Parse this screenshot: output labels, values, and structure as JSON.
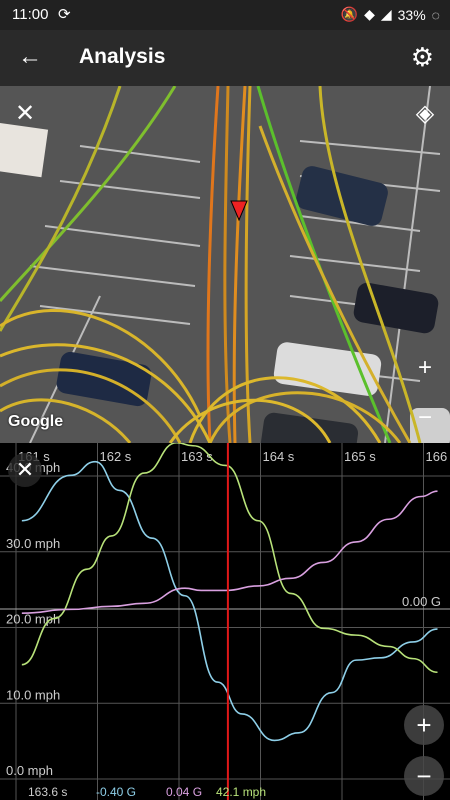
{
  "status": {
    "time": "11:00",
    "battery": "33%"
  },
  "header": {
    "title": "Analysis"
  },
  "icons": {
    "back": "arrow-back-icon",
    "settings": "gear-icon",
    "close": "close-icon",
    "layers": "layers-icon",
    "zoom_in": "plus-icon",
    "zoom_out": "minus-icon",
    "sync": "sync-icon"
  },
  "map": {
    "attribution": "Google"
  },
  "chart_data": {
    "type": "line",
    "x_ticks": [
      "161 s",
      "162 s",
      "163 s",
      "164 s",
      "165 s",
      "166"
    ],
    "y_ticks": [
      "40.0 mph",
      "30.0 mph",
      "20.0 mph",
      "10.0 mph",
      "0.0 mph"
    ],
    "g_label": "0.00 G",
    "series": [
      {
        "color": "#8ecfe8",
        "x": [
          160.9,
          161.5,
          161.8,
          162.1,
          162.5,
          162.9,
          163.3,
          163.6,
          164.0,
          164.3,
          164.7,
          165.0,
          165.3,
          165.7,
          166.0
        ],
        "y": [
          33.3,
          39.3,
          41.1,
          37.3,
          31.0,
          23.4,
          12.0,
          7.8,
          4.3,
          5.3,
          10.6,
          14.9,
          15.2,
          17.3,
          19.0
        ]
      },
      {
        "color": "#b8e27a",
        "x": [
          160.9,
          161.3,
          161.7,
          162.0,
          162.4,
          162.8,
          163.0,
          163.4,
          163.8,
          164.2,
          164.6,
          165.0,
          165.4,
          165.7,
          166.0
        ],
        "y": [
          14.3,
          20.4,
          26.9,
          31.3,
          39.6,
          43.6,
          43.2,
          40.6,
          33.3,
          23.7,
          19.1,
          18.2,
          16.7,
          15.1,
          13.3
        ]
      },
      {
        "color": "#d9a0e0",
        "x": [
          160.9,
          161.5,
          162.0,
          162.4,
          162.9,
          163.1,
          163.4,
          163.8,
          164.2,
          164.6,
          165.0,
          165.4,
          165.8,
          166.0
        ],
        "y": [
          21.1,
          21.6,
          22.0,
          22.4,
          24.4,
          24.1,
          24.1,
          24.7,
          25.7,
          27.8,
          30.5,
          33.5,
          36.5,
          37.2
        ]
      }
    ],
    "cursor_x": 163.6
  },
  "readout": {
    "time": "163.6 s",
    "long_g": "-0.40 G",
    "lat_g": "0.04 G",
    "speed": "42.1 mph"
  }
}
